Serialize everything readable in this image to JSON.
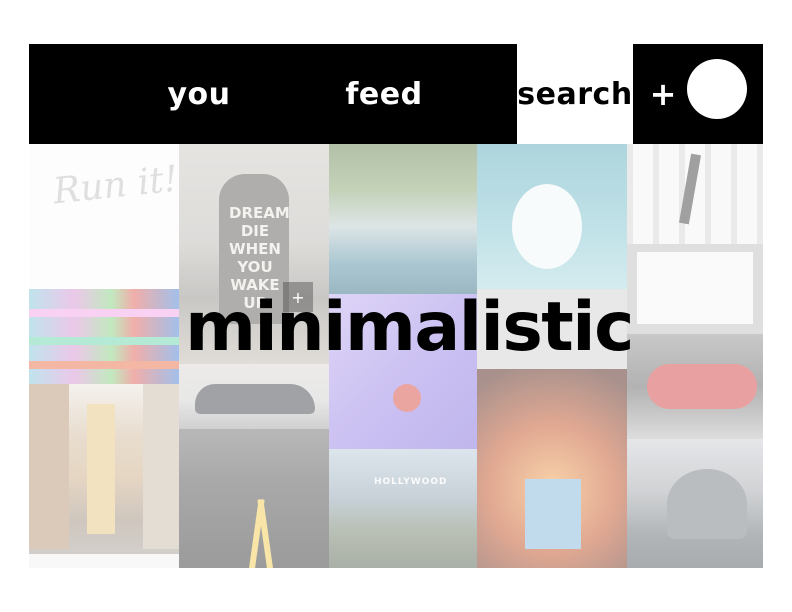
{
  "nav": {
    "you_label": "you",
    "feed_label": "feed",
    "search_label": "search",
    "add_label": "+"
  },
  "gallery": {
    "headline": "minimalistic",
    "tiles": {
      "run_text": "Run it!",
      "dream_text": "DREAM DIE WHEN YOU WAKE UP",
      "hollywood_text": "HOLLYWOOD"
    }
  },
  "colors": {
    "topbar": "#000000",
    "active_tab_bg": "#ffffff",
    "text_inverse": "#ffffff"
  },
  "icons": {
    "add": "plus-icon",
    "avatar": "user-avatar-circle"
  }
}
